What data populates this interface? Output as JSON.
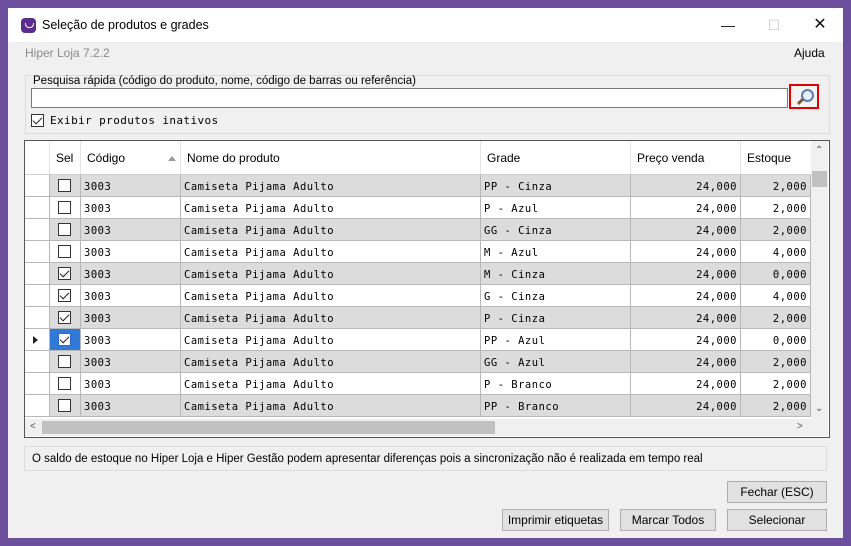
{
  "window": {
    "title": "Seleção de produtos e grades",
    "minimize_glyph": "—",
    "maximize_glyph": "☐",
    "close_glyph": "✕",
    "version": "Hiper Loja 7.2.2",
    "help_label": "Ajuda"
  },
  "search": {
    "label": "Pesquisa rápida (código do produto, nome, código de barras ou referência)",
    "value": "",
    "placeholder": "",
    "show_inactive_label": "Exibir produtos inativos",
    "show_inactive_checked": true,
    "highlight_color": "#e00000"
  },
  "grid": {
    "columns": {
      "sel": "Sel",
      "codigo": "Código",
      "nome": "Nome do produto",
      "grade": "Grade",
      "preco": "Preço venda",
      "estoque": "Estoque"
    },
    "sorted_by": "Código",
    "rows": [
      {
        "checked": false,
        "codigo": "3003",
        "nome": "Camiseta Pijama Adulto",
        "grade": "PP - Cinza",
        "preco": "24,000",
        "estoque": "2,000"
      },
      {
        "checked": false,
        "codigo": "3003",
        "nome": "Camiseta Pijama Adulto",
        "grade": "P - Azul",
        "preco": "24,000",
        "estoque": "2,000"
      },
      {
        "checked": false,
        "codigo": "3003",
        "nome": "Camiseta Pijama Adulto",
        "grade": "GG - Cinza",
        "preco": "24,000",
        "estoque": "2,000"
      },
      {
        "checked": false,
        "codigo": "3003",
        "nome": "Camiseta Pijama Adulto",
        "grade": "M - Azul",
        "preco": "24,000",
        "estoque": "4,000"
      },
      {
        "checked": true,
        "codigo": "3003",
        "nome": "Camiseta Pijama Adulto",
        "grade": "M - Cinza",
        "preco": "24,000",
        "estoque": "0,000"
      },
      {
        "checked": true,
        "codigo": "3003",
        "nome": "Camiseta Pijama Adulto",
        "grade": "G - Cinza",
        "preco": "24,000",
        "estoque": "4,000"
      },
      {
        "checked": true,
        "codigo": "3003",
        "nome": "Camiseta Pijama Adulto",
        "grade": "P - Cinza",
        "preco": "24,000",
        "estoque": "2,000"
      },
      {
        "checked": true,
        "codigo": "3003",
        "nome": "Camiseta Pijama Adulto",
        "grade": "PP - Azul",
        "preco": "24,000",
        "estoque": "0,000",
        "current": true
      },
      {
        "checked": false,
        "codigo": "3003",
        "nome": "Camiseta Pijama Adulto",
        "grade": "GG - Azul",
        "preco": "24,000",
        "estoque": "2,000"
      },
      {
        "checked": false,
        "codigo": "3003",
        "nome": "Camiseta Pijama Adulto",
        "grade": "P - Branco",
        "preco": "24,000",
        "estoque": "2,000"
      },
      {
        "checked": false,
        "codigo": "3003",
        "nome": "Camiseta Pijama Adulto",
        "grade": "PP - Branco",
        "preco": "24,000",
        "estoque": "2,000"
      }
    ]
  },
  "notice": "O saldo de estoque no Hiper Loja e Hiper Gestão podem apresentar diferenças pois a sincronização não é realizada em tempo real",
  "buttons": {
    "close": "Fechar (ESC)",
    "print_labels": "Imprimir etiquetas",
    "mark_all": "Marcar Todos",
    "select": "Selecionar"
  }
}
